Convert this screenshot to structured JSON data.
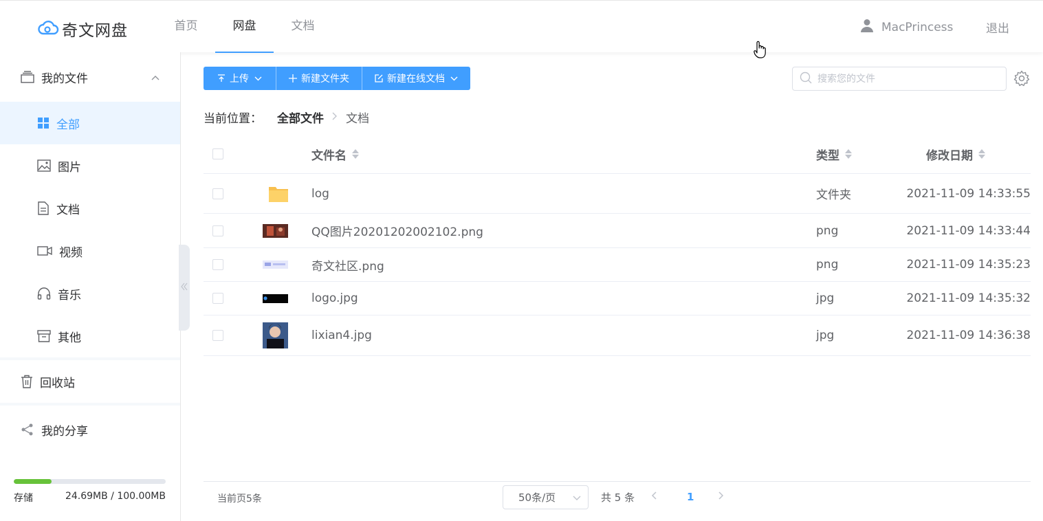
{
  "header": {
    "logo_text": "奇文网盘",
    "nav": [
      {
        "label": "首页",
        "active": false
      },
      {
        "label": "网盘",
        "active": true
      },
      {
        "label": "文档",
        "active": false
      }
    ],
    "user_name": "MacPrincess",
    "logout_label": "退出",
    "accent_color": "#409eff"
  },
  "sidebar": {
    "my_files_label": "我的文件",
    "items": [
      {
        "label": "全部",
        "icon": "grid-icon",
        "active": true
      },
      {
        "label": "图片",
        "icon": "image-icon",
        "active": false
      },
      {
        "label": "文档",
        "icon": "document-icon",
        "active": false
      },
      {
        "label": "视频",
        "icon": "video-icon",
        "active": false
      },
      {
        "label": "音乐",
        "icon": "headphones-icon",
        "active": false
      },
      {
        "label": "其他",
        "icon": "archive-icon",
        "active": false
      }
    ],
    "recycle_label": "回收站",
    "share_label": "我的分享",
    "storage": {
      "label": "存储",
      "usage_text": "24.69MB / 100.00MB",
      "used_fraction": 0.2469,
      "bar_color": "#67c23a"
    }
  },
  "toolbar": {
    "upload_label": "上传",
    "new_folder_label": "新建文件夹",
    "new_online_doc_label": "新建在线文档",
    "search_placeholder": "搜索您的文件"
  },
  "breadcrumb": {
    "label": "当前位置：",
    "root": "全部文件",
    "current": "文档"
  },
  "table": {
    "headers": {
      "name": "文件名",
      "type": "类型",
      "date": "修改日期"
    },
    "rows": [
      {
        "name": "log",
        "type": "文件夹",
        "date": "2021-11-09 14:33:55",
        "icon": "folder-icon"
      },
      {
        "name": "QQ图片20201202002102.png",
        "type": "png",
        "date": "2021-11-09 14:33:44",
        "icon": "image-thumbnail"
      },
      {
        "name": "奇文社区.png",
        "type": "png",
        "date": "2021-11-09 14:35:23",
        "icon": "image-thumbnail"
      },
      {
        "name": "logo.jpg",
        "type": "jpg",
        "date": "2021-11-09 14:35:32",
        "icon": "image-thumbnail"
      },
      {
        "name": "lixian4.jpg",
        "type": "jpg",
        "date": "2021-11-09 14:36:38",
        "icon": "image-thumbnail"
      }
    ]
  },
  "pagination": {
    "page_info": "当前页5条",
    "page_size": "50条/页",
    "total": "共 5 条",
    "current_page": "1"
  }
}
